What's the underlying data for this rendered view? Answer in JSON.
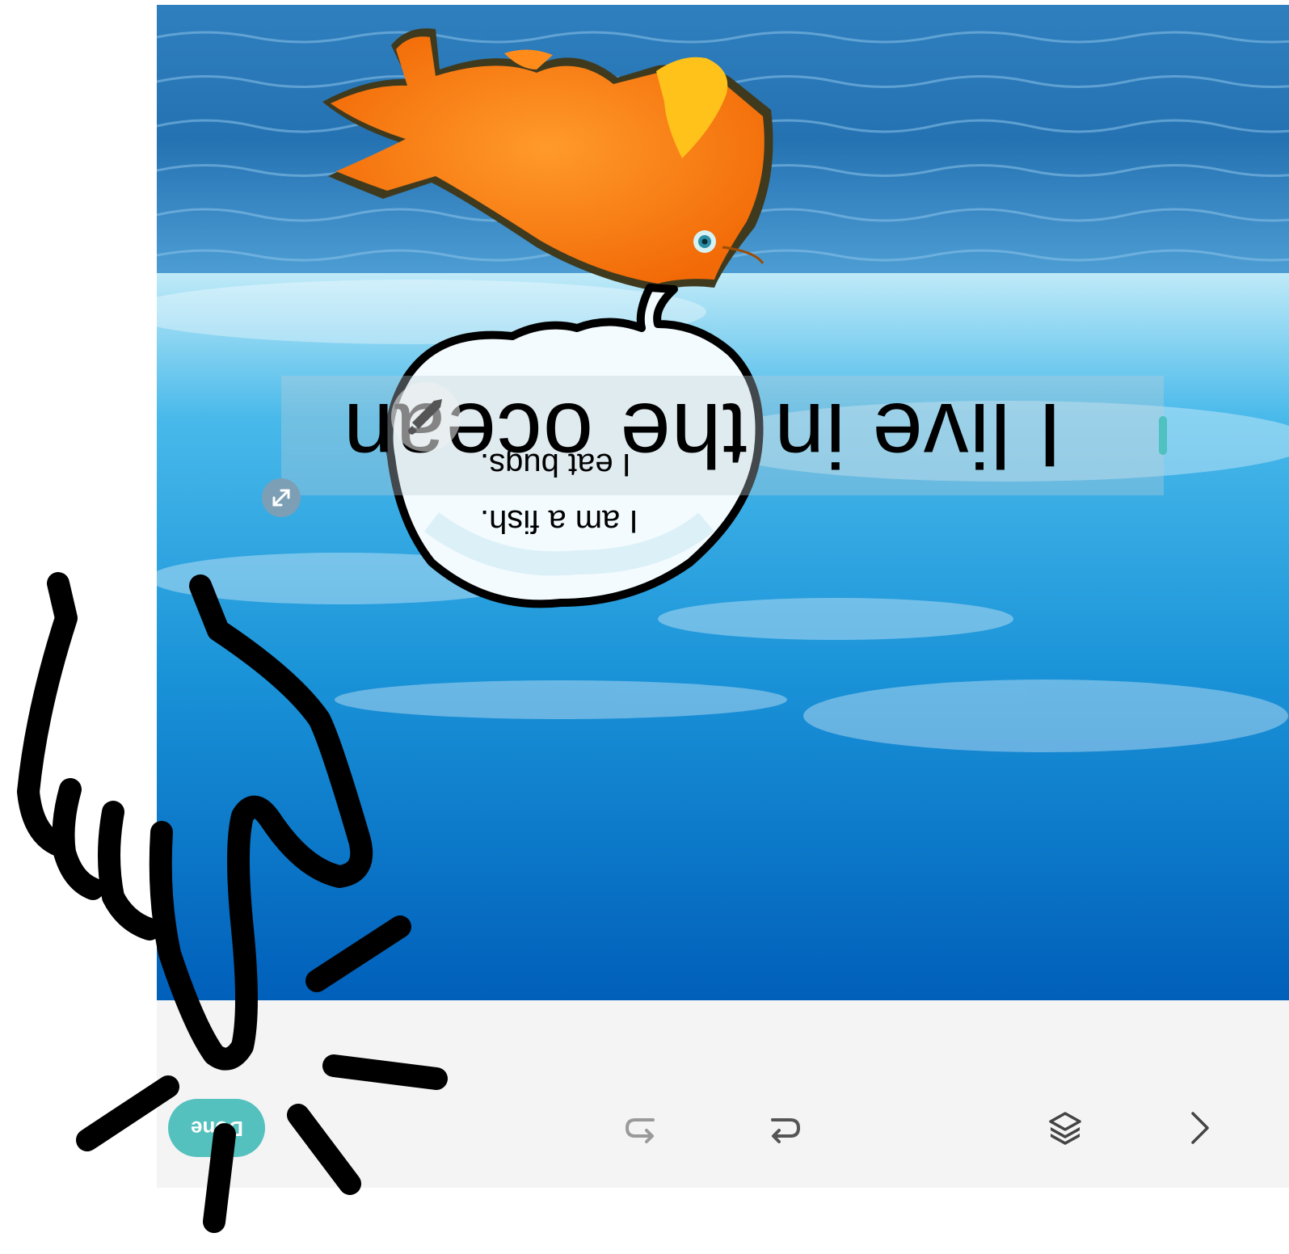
{
  "canvas": {
    "main_caption": "I live in the ocean",
    "bubble_lines": [
      "I eat bugs.",
      "I am a fish."
    ]
  },
  "toolbar": {
    "done_label": "Done",
    "icons": [
      "undo-icon",
      "redo-icon",
      "layers-icon",
      "chevron-right-icon"
    ]
  },
  "colors": {
    "accent": "#54c1bf",
    "fish_orange": "#ff7a12",
    "fin_yellow": "#ffc21a",
    "toolbar_bg": "#f4f4f4"
  }
}
